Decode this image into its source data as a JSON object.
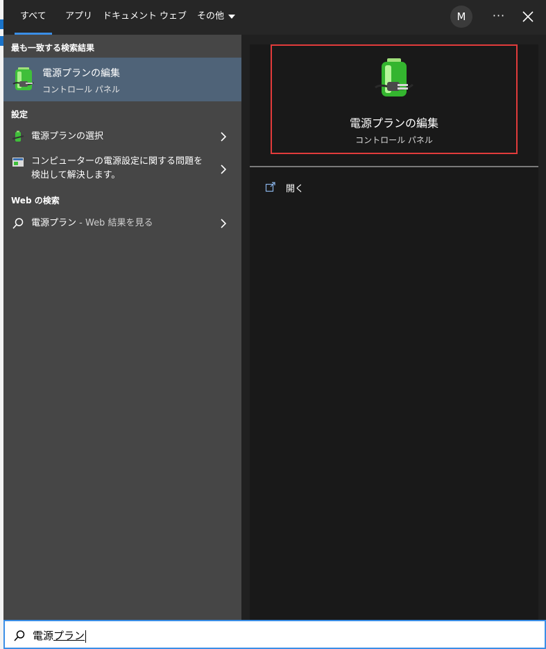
{
  "tabs": [
    {
      "label": "すべて",
      "active": true
    },
    {
      "label": "アプリ"
    },
    {
      "label": "ドキュメント"
    },
    {
      "label": "ウェブ"
    },
    {
      "label": "その他"
    }
  ],
  "user": {
    "avatar_letter": "M"
  },
  "toolbar": {
    "more_label": "···"
  },
  "left": {
    "best_match_title": "最も一致する検索結果",
    "best_match": {
      "title": "電源プランの編集",
      "subtitle": "コントロール パネル",
      "icon": "battery-plug-icon"
    },
    "settings_title": "設定",
    "settings": [
      {
        "label": "電源プランの選択",
        "icon": "power-plan-icon"
      },
      {
        "label_line1": "コンピューターの電源設定に関する問題を",
        "label_line2": "検出して解決します。",
        "icon": "troubleshoot-icon"
      }
    ],
    "web_title": "Web の検索",
    "web_result": {
      "query": "電源プラン",
      "suffix": " - Web 結果を見る",
      "icon": "search-icon"
    }
  },
  "preview": {
    "title": "電源プランの編集",
    "subtitle": "コントロール パネル",
    "open_label": "開く",
    "highlight_color": "#e23b3b"
  },
  "search": {
    "prefix": "電源",
    "underlined": "プラン",
    "accent": "#3a8ee6"
  }
}
